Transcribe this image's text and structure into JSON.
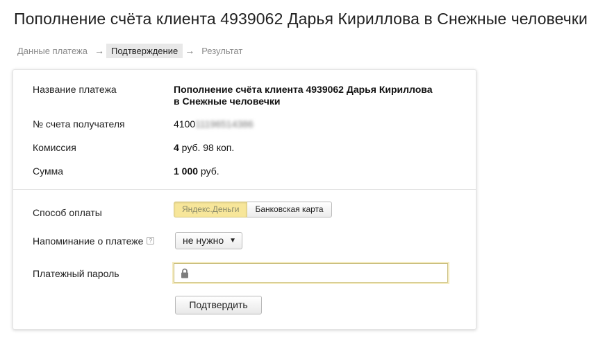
{
  "page_title": "Пополнение счёта клиента 4939062 Дарья Кириллова в Снежные человечки",
  "steps": [
    {
      "label": "Данные платежа",
      "active": false
    },
    {
      "label": "Подтверждение",
      "active": true
    },
    {
      "label": "Результат",
      "active": false
    }
  ],
  "step_arrow": "→",
  "details": {
    "payment_name_label": "Название платежа",
    "payment_name_line1": "Пополнение счёта клиента 4939062 Дарья Кириллова",
    "payment_name_line2": "в Снежные человечки",
    "account_label": "№ счета получателя",
    "account_prefix": "4100",
    "account_masked": "11196514386",
    "commission_label": "Комиссия",
    "commission_rub": "4",
    "commission_rest": " руб. 98 коп.",
    "sum_label": "Сумма",
    "sum_value": "1 000",
    "sum_unit": " руб."
  },
  "payment_form": {
    "method_label": "Способ оплаты",
    "method_options": [
      "Яндекс.Деньги",
      "Банковская карта"
    ],
    "method_selected": "Яндекс.Деньги",
    "reminder_label": "Напоминание о платеже",
    "reminder_hint_icon": "question-icon",
    "reminder_value": "не нужно",
    "reminder_arrow": "▼",
    "password_label": "Платежный пароль",
    "password_value": "",
    "password_icon": "lock-icon",
    "confirm_label": "Подтвердить"
  },
  "colors": {
    "selected_method_bg": "#f7e69a",
    "password_focus": "#f4ebc0"
  }
}
